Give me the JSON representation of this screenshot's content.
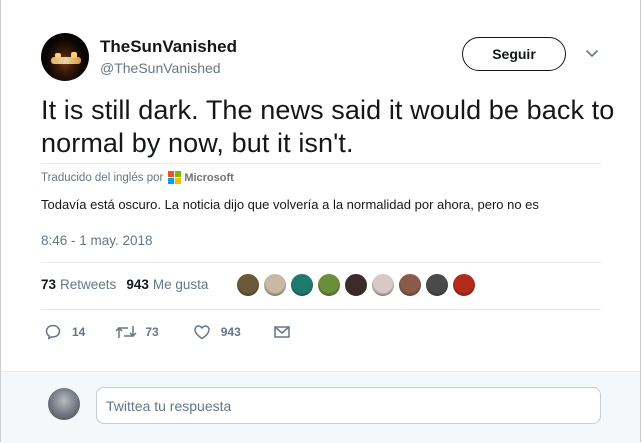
{
  "tweet": {
    "display_name": "TheSunVanished",
    "handle": "@TheSunVanished",
    "text": "It is still dark. The news said it would be back to normal by now, but it isn't.",
    "translated_from": "Traducido del inglés por",
    "translator": "Microsoft",
    "translation": "Todavía está oscuro. La noticia dijo que volvería a la normalidad por ahora, pero no es",
    "timestamp": "8:46 - 1 may. 2018"
  },
  "follow_button": {
    "label": "Seguir"
  },
  "stats": {
    "retweets_count": "73",
    "retweets_label": "Retweets",
    "likes_count": "943",
    "likes_label": "Me gusta"
  },
  "likers": [
    {
      "name": "liker-1",
      "color": "#6b5a3a"
    },
    {
      "name": "liker-2",
      "color": "#c9b9a4"
    },
    {
      "name": "liker-3",
      "color": "#1f7a6e"
    },
    {
      "name": "liker-4",
      "color": "#6a8f3a"
    },
    {
      "name": "liker-5",
      "color": "#3b2b2b"
    },
    {
      "name": "liker-6",
      "color": "#d8c8c8"
    },
    {
      "name": "liker-7",
      "color": "#8a5a4a"
    },
    {
      "name": "liker-8",
      "color": "#4a4a4a"
    },
    {
      "name": "liker-9",
      "color": "#b22a1a"
    }
  ],
  "actions": {
    "replies": "14",
    "retweets": "73",
    "likes": "943"
  },
  "icons": {
    "reply": "reply-icon",
    "retweet": "retweet-icon",
    "like": "heart-icon",
    "message": "envelope-icon",
    "more": "chevron-down-icon"
  },
  "reply_box": {
    "placeholder": "Twittea tu respuesta"
  },
  "colors": {
    "muted": "#657786",
    "text": "#14171a",
    "accent": "#1da1f2"
  }
}
